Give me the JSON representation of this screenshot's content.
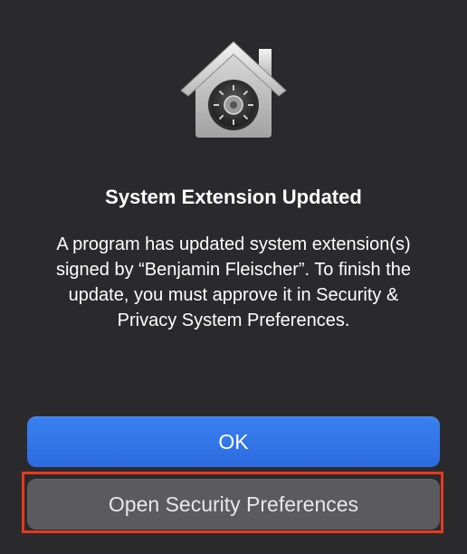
{
  "dialog": {
    "icon": "security-vault-house-icon",
    "title": "System Extension Updated",
    "message": "A program has updated system extension(s) signed by “Benjamin Fleischer”. To finish the update, you must approve it in Security & Privacy System Preferences.",
    "buttons": {
      "ok_label": "OK",
      "open_security_label": "Open Security Preferences"
    }
  },
  "colors": {
    "background": "#2a2a2c",
    "primary_button": "#3478f0",
    "secondary_button": "#5b5a5f",
    "highlight": "#e8391e"
  }
}
